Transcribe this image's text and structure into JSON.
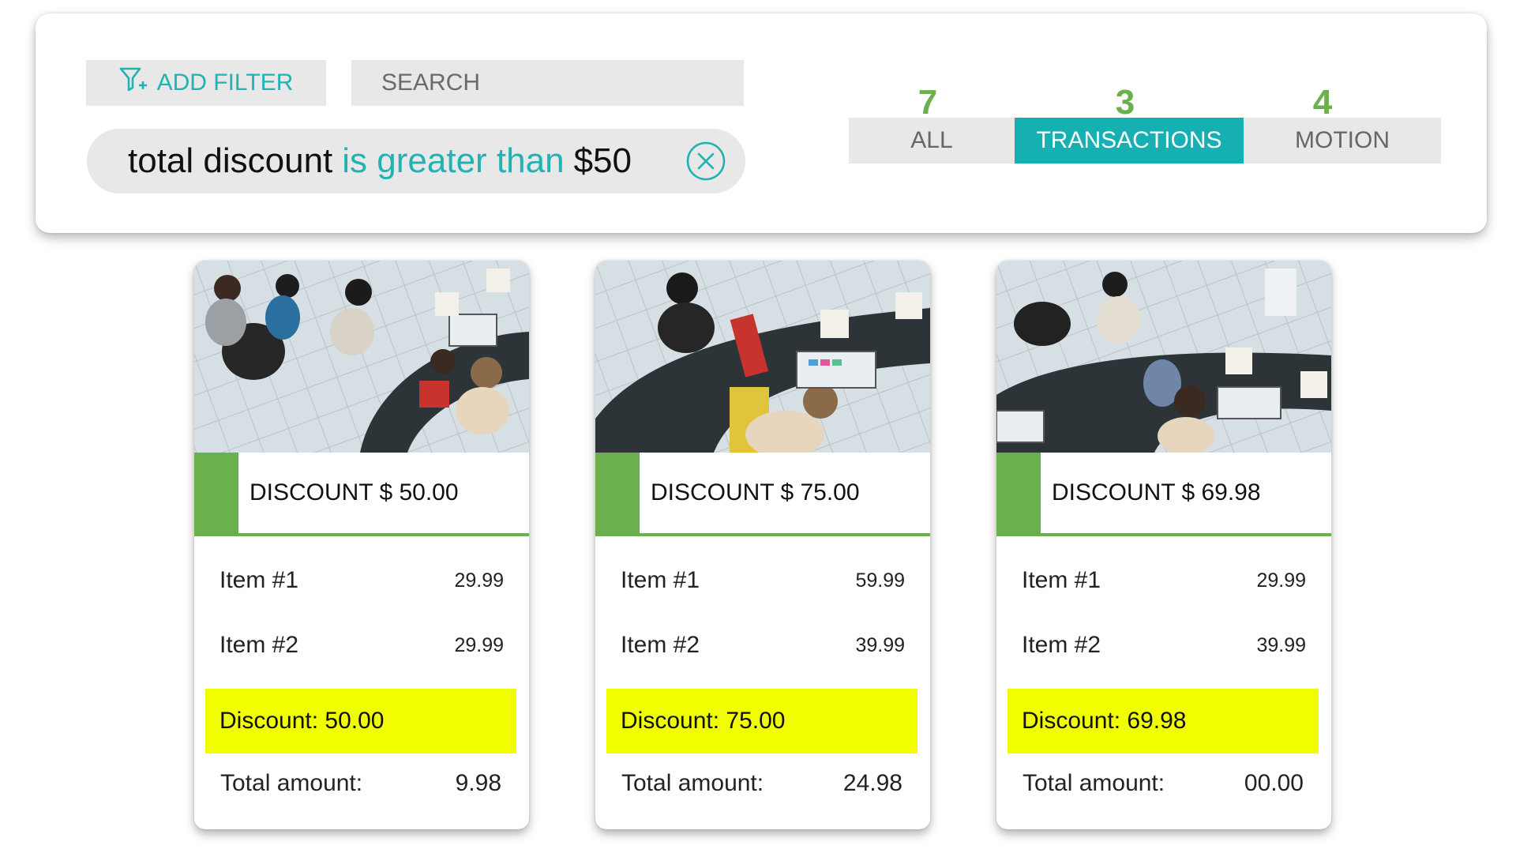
{
  "filter_bar": {
    "add_filter_label": "ADD FILTER",
    "search_placeholder": "SEARCH",
    "active_filter": {
      "field": "total discount",
      "operator": "is greater than",
      "value": "$50"
    }
  },
  "tabs": [
    {
      "label": "ALL",
      "count": "7",
      "active": false
    },
    {
      "label": "TRANSACTIONS",
      "count": "3",
      "active": true
    },
    {
      "label": "MOTION",
      "count": "4",
      "active": false
    }
  ],
  "colors": {
    "accent_teal": "#16b0b2",
    "accent_green": "#6ab04c",
    "highlight_yellow": "#f0fe00",
    "panel_grey": "#e8e8e8"
  },
  "cards": [
    {
      "header": "DISCOUNT $ 50.00",
      "items": [
        {
          "name": "Item #1",
          "price": "29.99"
        },
        {
          "name": "Item #2",
          "price": "29.99"
        }
      ],
      "discount_line": "Discount: 50.00",
      "total_label": "Total amount:",
      "total_value": "9.98"
    },
    {
      "header": "DISCOUNT $ 75.00",
      "items": [
        {
          "name": "Item #1",
          "price": "59.99"
        },
        {
          "name": "Item #2",
          "price": "39.99"
        }
      ],
      "discount_line": "Discount: 75.00",
      "total_label": "Total amount:",
      "total_value": "24.98"
    },
    {
      "header": "DISCOUNT $ 69.98",
      "items": [
        {
          "name": "Item #1",
          "price": "29.99"
        },
        {
          "name": "Item #2",
          "price": "39.99"
        }
      ],
      "discount_line": "Discount: 69.98",
      "total_label": "Total amount:",
      "total_value": "00.00"
    }
  ]
}
